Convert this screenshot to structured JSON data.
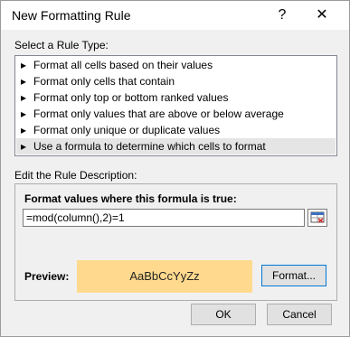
{
  "dialog": {
    "title": "New Formatting Rule",
    "help_glyph": "?",
    "close_glyph": "✕"
  },
  "rule_type": {
    "label": "Select a Rule Type:",
    "items": [
      "Format all cells based on their values",
      "Format only cells that contain",
      "Format only top or bottom ranked values",
      "Format only values that are above or below average",
      "Format only unique or duplicate values",
      "Use a formula to determine which cells to format"
    ],
    "selected_index": 5,
    "item_arrow": "▸"
  },
  "edit": {
    "label": "Edit the Rule Description:",
    "formula_label": "Format values where this formula is true:",
    "formula_value": "=mod(column(),2)=1",
    "preview_label": "Preview:",
    "preview_text": "AaBbCcYyZz",
    "preview_color": "#ffd98e",
    "format_button": "Format..."
  },
  "footer": {
    "ok": "OK",
    "cancel": "Cancel"
  }
}
